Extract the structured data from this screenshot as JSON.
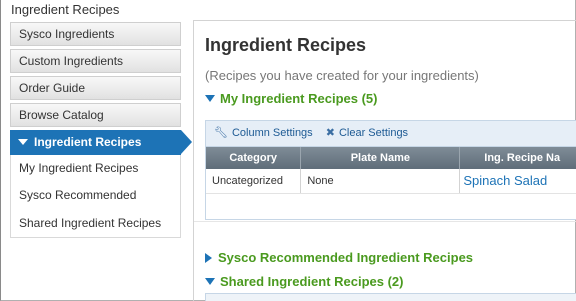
{
  "window": {
    "title": "Ingredient Recipes"
  },
  "sidebar": {
    "top_items": [
      {
        "label": "Sysco Ingredients"
      },
      {
        "label": "Custom Ingredients"
      },
      {
        "label": "Order Guide"
      },
      {
        "label": "Browse Catalog"
      }
    ],
    "active_item": {
      "label": "Ingredient Recipes",
      "icon": "caret-down-icon"
    },
    "sub_items": [
      {
        "label": "My Ingredient Recipes"
      },
      {
        "label": "Sysco Recommended"
      },
      {
        "label": "Shared Ingredient Recipes"
      }
    ]
  },
  "main": {
    "title": "Ingredient Recipes",
    "subtitle": "(Recipes you have created for your ingredients)",
    "sections": {
      "my_recipes": {
        "label": "My Ingredient Recipes (5)",
        "expanded": true
      },
      "sysco_recommended": {
        "label": "Sysco Recommended Ingredient Recipes",
        "expanded": false
      },
      "shared_recipes": {
        "label": "Shared Ingredient Recipes (2)",
        "expanded": true
      }
    },
    "grid": {
      "toolbar": {
        "column_settings": "Column Settings",
        "clear_settings": "Clear Settings",
        "column_settings_icon": "wrench-icon",
        "clear_settings_icon": "x-icon"
      },
      "columns": [
        "Category",
        "Plate Name",
        "Ing. Recipe Na"
      ],
      "rows": [
        {
          "category": "Uncategorized",
          "plate_name": "None",
          "recipe_name": "Spinach Salad"
        }
      ]
    }
  },
  "colors": {
    "accent": "#1d73b6",
    "section_header": "#4a9a1f",
    "table_header": "#6e7b86",
    "toolbar_bg": "#e6eef7"
  }
}
